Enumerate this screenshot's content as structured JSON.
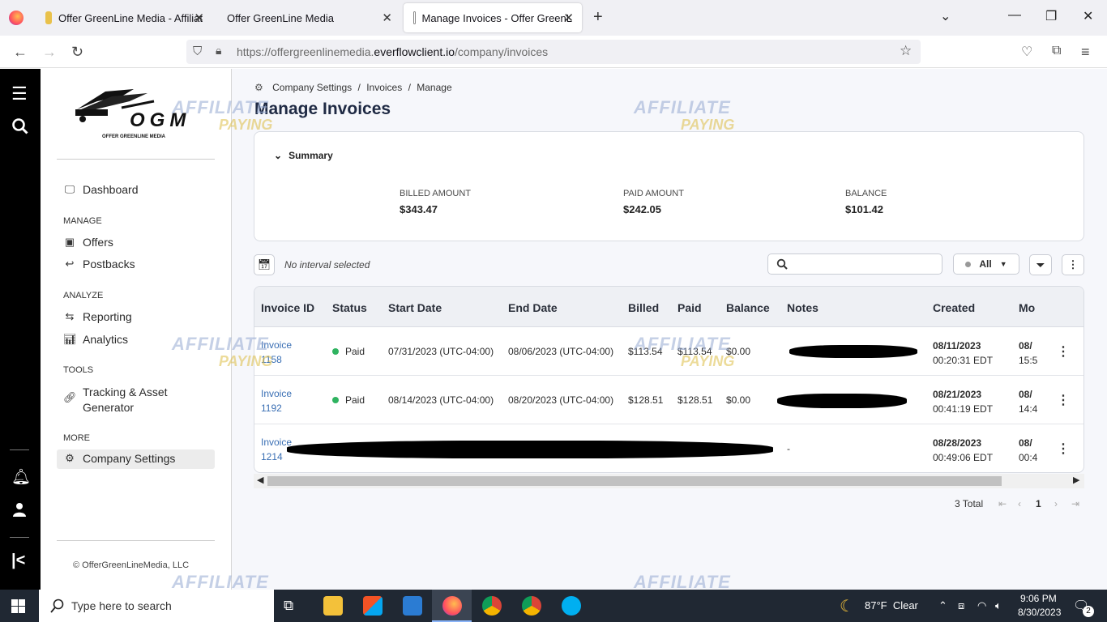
{
  "browser": {
    "tabs": [
      {
        "label": "Offer GreenLine Media - Affiliat"
      },
      {
        "label": "Offer GreenLine Media"
      },
      {
        "label": "Manage Invoices - Offer GreenL"
      }
    ],
    "url_prefix": "https://offergreenlinemedia.",
    "url_domain": "everflowclient.io",
    "url_path": "/company/invoices"
  },
  "sidebar": {
    "logo_text": "OGM",
    "logo_sub": "OFFER GREENLINE MEDIA",
    "dashboard": "Dashboard",
    "sections": {
      "manage": "MANAGE",
      "analyze": "ANALYZE",
      "tools": "TOOLS",
      "more": "MORE"
    },
    "items": {
      "offers": "Offers",
      "postbacks": "Postbacks",
      "reporting": "Reporting",
      "analytics": "Analytics",
      "tracking_line1": "Tracking & Asset",
      "tracking_line2": "Generator",
      "company_settings": "Company Settings"
    },
    "footer": "© OfferGreenLineMedia, LLC"
  },
  "breadcrumb": {
    "items": [
      "Company Settings",
      "Invoices",
      "Manage"
    ],
    "sep": "/"
  },
  "page_title": "Manage Invoices",
  "summary": {
    "toggle_label": "Summary",
    "billed_label": "BILLED AMOUNT",
    "billed_value": "$343.47",
    "paid_label": "PAID AMOUNT",
    "paid_value": "$242.05",
    "balance_label": "BALANCE",
    "balance_value": "$101.42"
  },
  "toolbar": {
    "interval_text": "No interval selected",
    "filter_select": "All"
  },
  "table": {
    "headers": [
      "Invoice ID",
      "Status",
      "Start Date",
      "End Date",
      "Billed",
      "Paid",
      "Balance",
      "Notes",
      "Created",
      "Mo"
    ],
    "rows": [
      {
        "invoice_line1": "Invoice",
        "invoice_line2": "1158",
        "status": "Paid",
        "start": "07/31/2023 (UTC-04:00)",
        "end": "08/06/2023 (UTC-04:00)",
        "billed": "$113.54",
        "paid": "$113.54",
        "balance": "$0.00",
        "notes": "",
        "created_date": "08/11/2023",
        "created_time": "00:20:31 EDT",
        "mod_date": "08/",
        "mod_time": "15:5"
      },
      {
        "invoice_line1": "Invoice",
        "invoice_line2": "1192",
        "status": "Paid",
        "start": "08/14/2023 (UTC-04:00)",
        "end": "08/20/2023 (UTC-04:00)",
        "billed": "$128.51",
        "paid": "$128.51",
        "balance": "$0.00",
        "notes": "",
        "created_date": "08/21/2023",
        "created_time": "00:41:19 EDT",
        "mod_date": "08/",
        "mod_time": "14:4"
      },
      {
        "invoice_line1": "Invoice",
        "invoice_line2": "1214",
        "status": "",
        "start": "",
        "end": "",
        "billed": "",
        "paid": "",
        "balance": "",
        "notes": "-",
        "created_date": "08/28/2023",
        "created_time": "00:49:06 EDT",
        "mod_date": "08/",
        "mod_time": "00:4"
      }
    ]
  },
  "pager": {
    "total": "3 Total",
    "page": "1"
  },
  "watermark": {
    "line1": "AFFILIATE",
    "line2": "PAYING"
  },
  "taskbar": {
    "search_placeholder": "Type here to search",
    "weather": "87°F  Clear",
    "time": "9:06 PM",
    "date": "8/30/2023",
    "notif_count": "2"
  },
  "colors": {
    "rail": "#000000",
    "accent_link": "#3a6fb4",
    "paid_dot": "#2fb360",
    "title": "#1f2a44"
  }
}
